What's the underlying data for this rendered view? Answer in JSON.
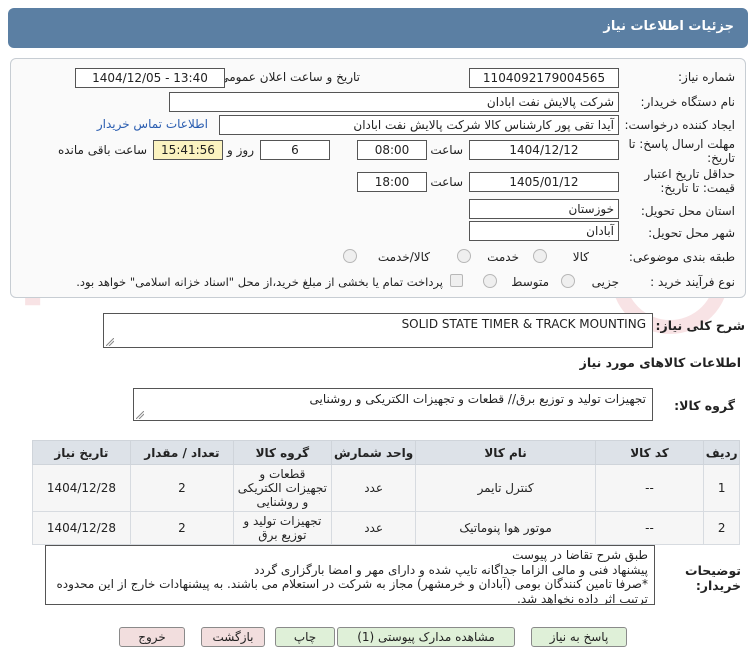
{
  "header": {
    "title": "جزئیات اطلاعات نیاز"
  },
  "form": {
    "need_number_label": "شماره نیاز:",
    "need_number": "1104092179004565",
    "announce_label": "تاریخ و ساعت اعلان عمومی:",
    "announce_value": "1404/12/05 - 13:40",
    "buyer_org_label": "نام دستگاه خریدار:",
    "buyer_org": "شرکت پالایش نفت ابادان",
    "creator_label": "ایجاد کننده درخواست:",
    "creator": "آیدا تقی پور کارشناس کالا شرکت پالایش نفت ابادان",
    "contact_link": "اطلاعات تماس خریدار",
    "deadline_label_1": "مهلت ارسال پاسخ: تا",
    "deadline_label_2": "تاریخ:",
    "deadline_date": "1404/12/12",
    "time_label": "ساعت",
    "deadline_time": "08:00",
    "days_count": "6",
    "days_label": "روز و",
    "remaining_time": "15:41:56",
    "remaining_label": "ساعت باقی مانده",
    "validity_label_1": "حداقل تاریخ اعتبار",
    "validity_label_2": "قیمت: تا تاریخ:",
    "validity_date": "1405/01/12",
    "validity_time": "18:00",
    "province_label": "استان محل تحویل:",
    "province": "خوزستان",
    "city_label": "شهر محل تحویل:",
    "city": "آبادان",
    "category_label": "طبقه بندی موضوعی:",
    "category_options": [
      "کالا",
      "خدمت",
      "کالا/خدمت"
    ],
    "process_label": "نوع فرآیند خرید :",
    "process_options": [
      "جزیی",
      "متوسط"
    ],
    "payment_note": "پرداخت تمام یا بخشی از مبلغ خرید،از محل \"اسناد خزانه اسلامی\" خواهد بود."
  },
  "summary": {
    "label": "شرح کلی نیاز:",
    "value": "SOLID STATE TIMER & TRACK MOUNTING"
  },
  "goods_section": {
    "title": "اطلاعات کالاهای مورد نیاز",
    "group_label": "گروه کالا:",
    "group_value": "تجهیزات تولید و توزیع برق// قطعات و تجهیزات الکتریکی و روشنایی"
  },
  "table": {
    "headers": [
      "ردیف",
      "کد کالا",
      "نام کالا",
      "واحد شمارش",
      "گروه کالا",
      "تعداد / مقدار",
      "تاریخ نیاز"
    ],
    "rows": [
      [
        "1",
        "--",
        "کنترل تایمر",
        "عدد",
        "قطعات و تجهیزات الکتریکی و روشنایی",
        "2",
        "1404/12/28"
      ],
      [
        "2",
        "--",
        "موتور هوا پنوماتیک",
        "عدد",
        "تجهیزات تولید و توزیع برق",
        "2",
        "1404/12/28"
      ]
    ]
  },
  "buyer_notes": {
    "label_1": "توضیحات",
    "label_2": "خریدار:",
    "lines": [
      "طبق شرح تقاضا در پیوست",
      "پیشنهاد فنی و مالی الزاما جداگانه تایپ شده و دارای مهر و امضا بارگزاری گردد",
      "*صرفا تامین کنندگان بومی (آبادان و خرمشهر) مجاز به شرکت در استعلام می باشند. به پیشنهادات خارج از این محدوده",
      "ترتیب اثر داده نخواهد شد."
    ]
  },
  "buttons": {
    "reply": "پاسخ به نیاز",
    "attachments": "مشاهده مدارک پیوستی (1)",
    "print": "چاپ",
    "back": "بازگشت",
    "exit": "خروج"
  },
  "colors": {
    "header_bg": "#5b7fa3",
    "button_green": "#dff0d8",
    "button_red": "#f2dede",
    "highlight_yellow": "#fbf3c0"
  }
}
